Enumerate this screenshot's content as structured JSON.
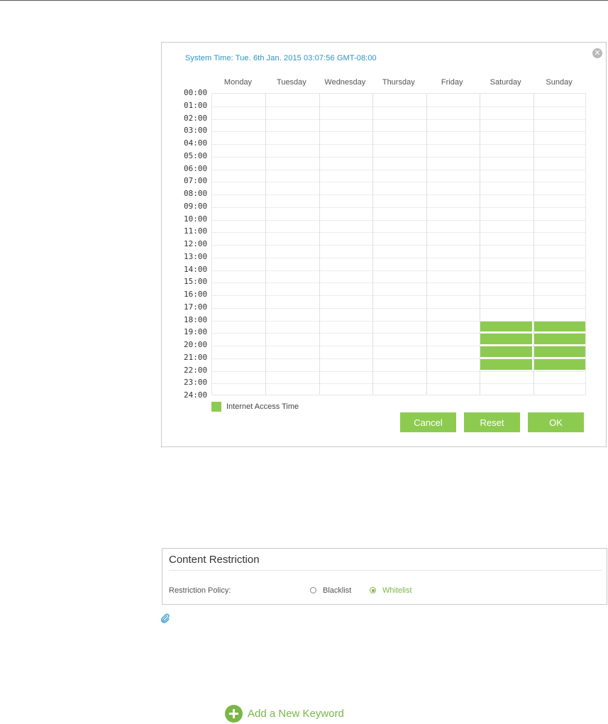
{
  "schedule": {
    "system_time": "System Time: Tue. 6th Jan. 2015 03:07:56 GMT-08:00",
    "close_icon": "close-icon",
    "days": [
      "Monday",
      "Tuesday",
      "Wednesday",
      "Thursday",
      "Friday",
      "Saturday",
      "Sunday"
    ],
    "hours": [
      "00:00",
      "01:00",
      "02:00",
      "03:00",
      "04:00",
      "05:00",
      "06:00",
      "07:00",
      "08:00",
      "09:00",
      "10:00",
      "11:00",
      "12:00",
      "13:00",
      "14:00",
      "15:00",
      "16:00",
      "17:00",
      "18:00",
      "19:00",
      "20:00",
      "21:00",
      "22:00",
      "23:00",
      "24:00"
    ],
    "selected_slots": {
      "Saturday": [
        "18:00",
        "19:00",
        "20:00",
        "21:00"
      ],
      "Sunday": [
        "18:00",
        "19:00",
        "20:00",
        "21:00"
      ]
    },
    "legend_label": "Internet Access Time",
    "accent_color": "#8dcb50",
    "buttons": {
      "cancel": "Cancel",
      "reset": "Reset",
      "ok": "OK"
    }
  },
  "content_restriction": {
    "title": "Content Restriction",
    "policy_label": "Restriction Policy:",
    "options": [
      {
        "label": "Blacklist",
        "selected": false
      },
      {
        "label": "Whitelist",
        "selected": true
      }
    ],
    "note_icon": "paperclip-icon"
  },
  "add_keyword": {
    "label": "Add a New Keyword",
    "icon": "plus-circle-icon"
  }
}
